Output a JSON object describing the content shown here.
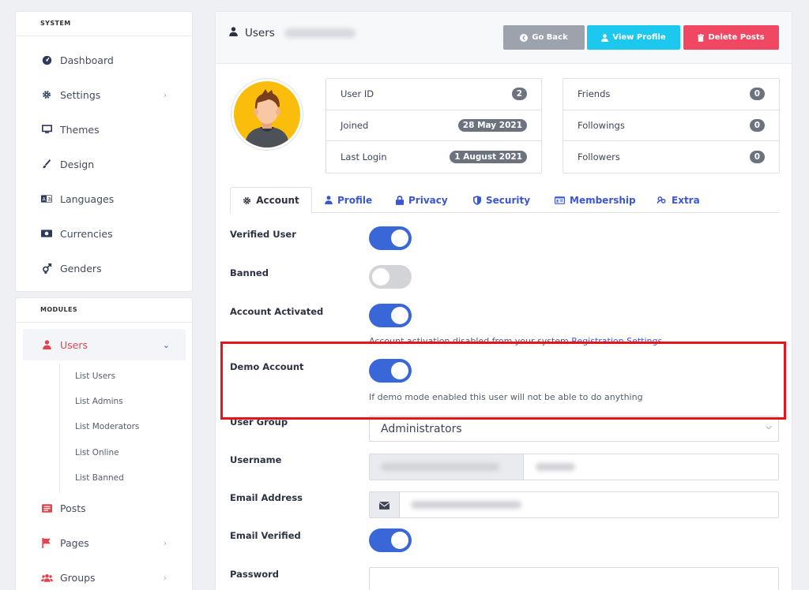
{
  "sidebar": {
    "system_header": "SYSTEM",
    "modules_header": "MODULES",
    "system_items": [
      {
        "label": "Dashboard",
        "icon": "dashboard-icon"
      },
      {
        "label": "Settings",
        "icon": "gear-icon"
      },
      {
        "label": "Themes",
        "icon": "monitor-icon"
      },
      {
        "label": "Design",
        "icon": "brush-icon"
      },
      {
        "label": "Languages",
        "icon": "language-icon"
      },
      {
        "label": "Currencies",
        "icon": "money-icon"
      },
      {
        "label": "Genders",
        "icon": "genderless-icon"
      }
    ],
    "module_items": [
      {
        "label": "Users",
        "icon": "user-icon"
      },
      {
        "label": "Posts",
        "icon": "newspaper-icon"
      },
      {
        "label": "Pages",
        "icon": "flag-icon"
      },
      {
        "label": "Groups",
        "icon": "users-icon"
      }
    ],
    "user_sub_items": [
      "List Users",
      "List Admins",
      "List Moderators",
      "List Online",
      "List Banned"
    ]
  },
  "header": {
    "title": "Users",
    "buttons": {
      "back": "Go Back",
      "view": "View Profile",
      "delete": "Delete Posts"
    }
  },
  "stats_left": [
    {
      "label": "User ID",
      "value": "2"
    },
    {
      "label": "Joined",
      "value": "28 May 2021"
    },
    {
      "label": "Last Login",
      "value": "1 August 2021"
    }
  ],
  "stats_right": [
    {
      "label": "Friends",
      "value": "0"
    },
    {
      "label": "Followings",
      "value": "0"
    },
    {
      "label": "Followers",
      "value": "0"
    }
  ],
  "tabs": [
    {
      "label": "Account",
      "icon": "gear-icon"
    },
    {
      "label": "Profile",
      "icon": "user-icon"
    },
    {
      "label": "Privacy",
      "icon": "lock-icon"
    },
    {
      "label": "Security",
      "icon": "shield-icon"
    },
    {
      "label": "Membership",
      "icon": "id-card-icon"
    },
    {
      "label": "Extra",
      "icon": "link-icon"
    }
  ],
  "form": {
    "verified_user": {
      "label": "Verified User",
      "on": true
    },
    "banned": {
      "label": "Banned",
      "on": false
    },
    "account_activated": {
      "label": "Account Activated",
      "on": true,
      "help_prefix": "Account activation disabled from your system ",
      "help_link": "Registration Settings"
    },
    "demo_account": {
      "label": "Demo Account",
      "on": true,
      "help": "If demo mode enabled this user will not be able to do anything"
    },
    "user_group": {
      "label": "User Group",
      "value": "Administrators"
    },
    "username": {
      "label": "Username"
    },
    "email": {
      "label": "Email Address"
    },
    "email_verified": {
      "label": "Email Verified",
      "on": true
    },
    "password": {
      "label": "Password"
    }
  },
  "colors": {
    "primary": "#3a67d8",
    "danger": "#f04862",
    "info": "#1cc8ee",
    "secondary": "#9da3ad",
    "highlight": "#e8141c"
  }
}
